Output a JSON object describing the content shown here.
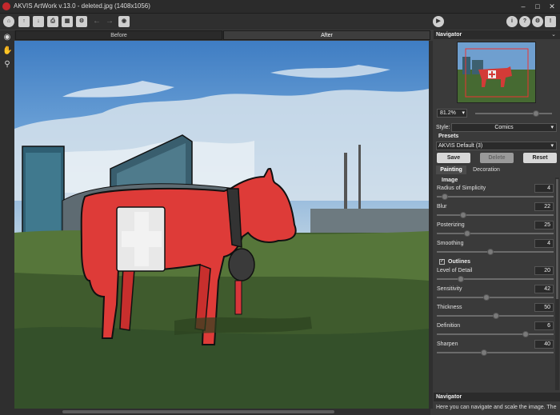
{
  "window": {
    "title": "AKVIS ArtWork v.13.0 - deleted.jpg (1408x1056)"
  },
  "toolbar": {
    "left_icons": [
      "home-icon",
      "open-file-icon",
      "save-file-icon",
      "print-icon",
      "batch-icon",
      "plugin-icon",
      "undo-icon",
      "redo-icon",
      "share-icon"
    ],
    "right_icons": [
      "run-icon",
      "info-icon",
      "help-icon",
      "settings-icon",
      "notification-icon"
    ]
  },
  "view_tabs": {
    "before": "Before",
    "after": "After"
  },
  "navigator": {
    "title": "Navigator",
    "zoom": "81.2%",
    "zoom_fraction": 0.78
  },
  "style": {
    "label": "Style:",
    "value": "Comics"
  },
  "presets": {
    "label": "Presets",
    "value": "AKVIS Default (3)",
    "save": "Save",
    "delete": "Delete",
    "reset": "Reset"
  },
  "param_tabs": {
    "painting": "Painting",
    "decoration": "Decoration"
  },
  "image_section": {
    "title": "Image",
    "params": [
      {
        "label": "Radius of Simplicity",
        "value": "4",
        "fraction": 0.06
      },
      {
        "label": "Blur",
        "value": "22",
        "fraction": 0.22
      },
      {
        "label": "Posterizing",
        "value": "25",
        "fraction": 0.25
      },
      {
        "label": "Smoothing",
        "value": "4",
        "fraction": 0.45
      }
    ]
  },
  "outlines_section": {
    "title": "Outlines",
    "checked": true,
    "params": [
      {
        "label": "Level of Detail",
        "value": "20",
        "fraction": 0.2
      },
      {
        "label": "Sensitivity",
        "value": "42",
        "fraction": 0.42
      },
      {
        "label": "Thickness",
        "value": "50",
        "fraction": 0.5
      },
      {
        "label": "Definition",
        "value": "6",
        "fraction": 0.75
      },
      {
        "label": "Sharpen",
        "value": "40",
        "fraction": 0.4
      }
    ]
  },
  "help_panel": {
    "title": "Navigator",
    "text": "Here you can navigate and scale the image. The"
  }
}
